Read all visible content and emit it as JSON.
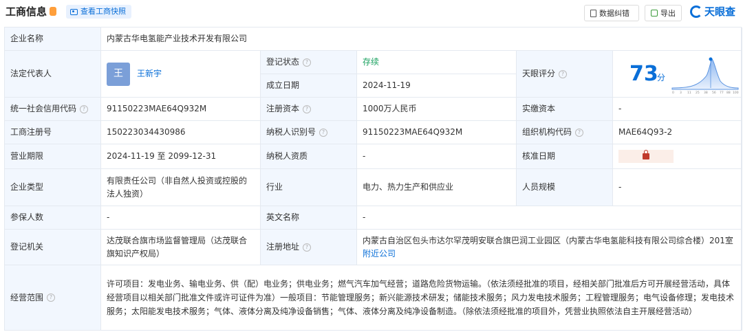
{
  "header": {
    "title": "工商信息",
    "snapshot_label": "查看工商快照",
    "correction_label": "数据纠错",
    "export_label": "导出",
    "brand": "天眼查"
  },
  "table": {
    "company_name_label": "企业名称",
    "company_name": "内蒙古华电氢能产业技术开发有限公司",
    "legal_rep_label": "法定代表人",
    "legal_rep_avatar": "王",
    "legal_rep_name": "王新宇",
    "reg_status_label": "登记状态",
    "reg_status": "存续",
    "found_date_label": "成立日期",
    "found_date": "2024-11-19",
    "score_label": "天眼评分",
    "score": "73",
    "score_unit": "分",
    "score_ticks": [
      "0",
      "3",
      "11",
      "25",
      "38",
      "56",
      "77",
      "88",
      "100"
    ],
    "credit_code_label": "统一社会信用代码",
    "credit_code": "91150223MAE64Q932M",
    "reg_capital_label": "注册资本",
    "reg_capital": "1000万人民币",
    "paid_capital_label": "实缴资本",
    "paid_capital": "-",
    "biz_reg_no_label": "工商注册号",
    "biz_reg_no": "150223034430986",
    "taxpayer_id_label": "纳税人识别号",
    "taxpayer_id": "91150223MAE64Q932M",
    "org_code_label": "组织机构代码",
    "org_code": "MAE64Q93-2",
    "term_label": "营业期限",
    "term": "2024-11-19 至 2099-12-31",
    "taxpayer_qual_label": "纳税人资质",
    "taxpayer_qual": "-",
    "approve_date_label": "核准日期",
    "type_label": "企业类型",
    "type": "有限责任公司（非自然人投资或控股的法人独资）",
    "industry_label": "行业",
    "industry": "电力、热力生产和供应业",
    "staff_label": "人员规模",
    "staff": "-",
    "insured_label": "参保人数",
    "insured": "-",
    "english_name_label": "英文名称",
    "english_name": "-",
    "authority_label": "登记机关",
    "authority": "达茂联合旗市场监督管理局（达茂联合旗知识产权局）",
    "address_label": "注册地址",
    "address": "内蒙古自治区包头市达尔罕茂明安联合旗巴润工业园区（内蒙古华电氢能科技有限公司综合楼）201室",
    "nearby_label": "附近公司",
    "scope_label": "经营范围",
    "scope": "许可项目：发电业务、输电业务、供（配）电业务；供电业务；燃气汽车加气经营；道路危险货物运输。（依法须经批准的项目，经相关部门批准后方可开展经营活动，具体经营项目以相关部门批准文件或许可证件为准）一般项目：节能管理服务；新兴能源技术研发；储能技术服务；风力发电技术服务；工程管理服务；电气设备修理；发电技术服务；太阳能发电技术服务；气体、液体分离及纯净设备销售；气体、液体分离及纯净设备制造。（除依法须经批准的项目外，凭营业执照依法自主开展经营活动）"
  },
  "colors": {
    "accent": "#0a6fd8",
    "label_bg": "#f2f7fe",
    "status_green": "#1aa15f"
  }
}
